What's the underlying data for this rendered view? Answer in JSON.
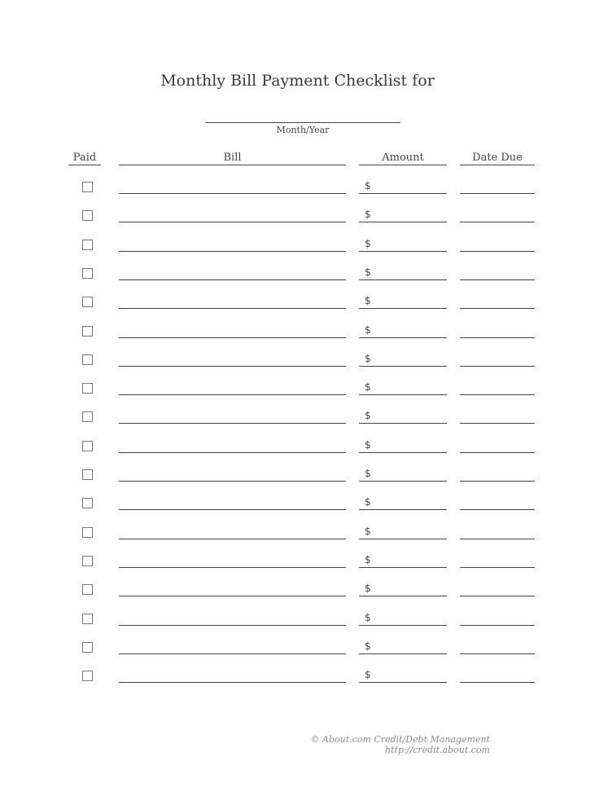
{
  "title": "Monthly Bill Payment Checklist for",
  "month_year": {
    "label": "Month/Year",
    "value": ""
  },
  "columns": {
    "paid": "Paid",
    "bill": "Bill",
    "amount": "Amount",
    "date_due": "Date Due"
  },
  "currency_symbol": "$",
  "rows": [
    {
      "paid": false,
      "bill": "",
      "amount": "",
      "date_due": ""
    },
    {
      "paid": false,
      "bill": "",
      "amount": "",
      "date_due": ""
    },
    {
      "paid": false,
      "bill": "",
      "amount": "",
      "date_due": ""
    },
    {
      "paid": false,
      "bill": "",
      "amount": "",
      "date_due": ""
    },
    {
      "paid": false,
      "bill": "",
      "amount": "",
      "date_due": ""
    },
    {
      "paid": false,
      "bill": "",
      "amount": "",
      "date_due": ""
    },
    {
      "paid": false,
      "bill": "",
      "amount": "",
      "date_due": ""
    },
    {
      "paid": false,
      "bill": "",
      "amount": "",
      "date_due": ""
    },
    {
      "paid": false,
      "bill": "",
      "amount": "",
      "date_due": ""
    },
    {
      "paid": false,
      "bill": "",
      "amount": "",
      "date_due": ""
    },
    {
      "paid": false,
      "bill": "",
      "amount": "",
      "date_due": ""
    },
    {
      "paid": false,
      "bill": "",
      "amount": "",
      "date_due": ""
    },
    {
      "paid": false,
      "bill": "",
      "amount": "",
      "date_due": ""
    },
    {
      "paid": false,
      "bill": "",
      "amount": "",
      "date_due": ""
    },
    {
      "paid": false,
      "bill": "",
      "amount": "",
      "date_due": ""
    },
    {
      "paid": false,
      "bill": "",
      "amount": "",
      "date_due": ""
    },
    {
      "paid": false,
      "bill": "",
      "amount": "",
      "date_due": ""
    },
    {
      "paid": false,
      "bill": "",
      "amount": "",
      "date_due": ""
    }
  ],
  "footer": {
    "copyright": "© About.com Credit/Debt Management",
    "url": "http://credit.about.com"
  }
}
